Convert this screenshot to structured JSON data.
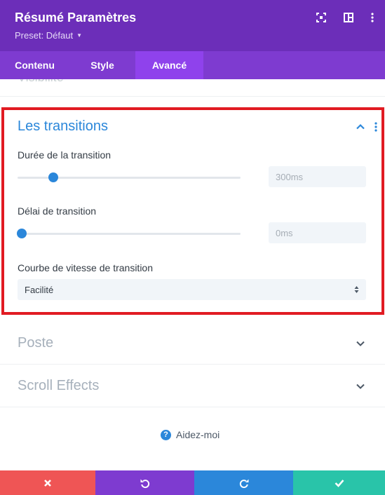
{
  "header": {
    "title": "Résumé Paramètres",
    "preset_label": "Preset: Défaut",
    "icons": [
      "fullscreen-icon",
      "split-view-icon",
      "more-options-icon"
    ]
  },
  "tabs": [
    {
      "label": "Contenu",
      "active": false
    },
    {
      "label": "Style",
      "active": false
    },
    {
      "label": "Avancé",
      "active": true
    }
  ],
  "sections": {
    "visibility": {
      "title": "Visibilité"
    },
    "transitions": {
      "title": "Les transitions",
      "expanded": true,
      "duration": {
        "label": "Durée de la transition",
        "value": "300ms",
        "slider_fraction": 0.16
      },
      "delay": {
        "label": "Délai de transition",
        "value": "0ms",
        "slider_fraction": 0.02
      },
      "curve": {
        "label": "Courbe de vitesse de transition",
        "selected": "Facilité"
      }
    },
    "position": {
      "title": "Poste",
      "expanded": false
    },
    "scroll_effects": {
      "title": "Scroll Effects",
      "expanded": false
    }
  },
  "help": {
    "label": "Aidez-moi",
    "icon": "question-icon"
  },
  "footer": {
    "buttons": [
      {
        "name": "cancel",
        "icon": "close-icon",
        "color": "#ef5555"
      },
      {
        "name": "undo",
        "icon": "undo-icon",
        "color": "#7e3bd0"
      },
      {
        "name": "redo",
        "icon": "redo-icon",
        "color": "#2b87da"
      },
      {
        "name": "save",
        "icon": "check-icon",
        "color": "#29c4a9"
      }
    ]
  },
  "colors": {
    "header_bg": "#6c2eb9",
    "tabs_bg": "#7e3bd0",
    "active_tab_bg": "#8f42ec",
    "accent_blue": "#2b87da",
    "highlight_border": "#e11b22"
  }
}
